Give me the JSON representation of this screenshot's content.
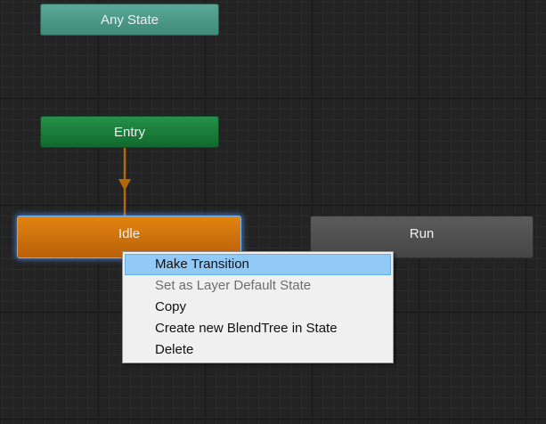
{
  "states": {
    "any_state": {
      "label": "Any State",
      "color": "#4a9a86"
    },
    "entry": {
      "label": "Entry",
      "color": "#1a7d3c"
    },
    "idle": {
      "label": "Idle",
      "color": "#d0720c",
      "selected": true,
      "default": true
    },
    "run": {
      "label": "Run",
      "color": "#515151"
    }
  },
  "transition": {
    "from": "Entry",
    "to": "Idle",
    "color": "#b06a09"
  },
  "context_menu": {
    "items": [
      {
        "label": "Make Transition",
        "highlighted": true,
        "enabled": true
      },
      {
        "label": "Set as Layer Default State",
        "highlighted": false,
        "enabled": false
      },
      {
        "label": "Copy",
        "highlighted": false,
        "enabled": true
      },
      {
        "label": "Create new BlendTree in State",
        "highlighted": false,
        "enabled": true
      },
      {
        "label": "Delete",
        "highlighted": false,
        "enabled": true
      }
    ]
  },
  "theme": {
    "grid_background": "#232323",
    "menu_background": "#f0f0f0",
    "menu_highlight": "#91c9f7"
  }
}
